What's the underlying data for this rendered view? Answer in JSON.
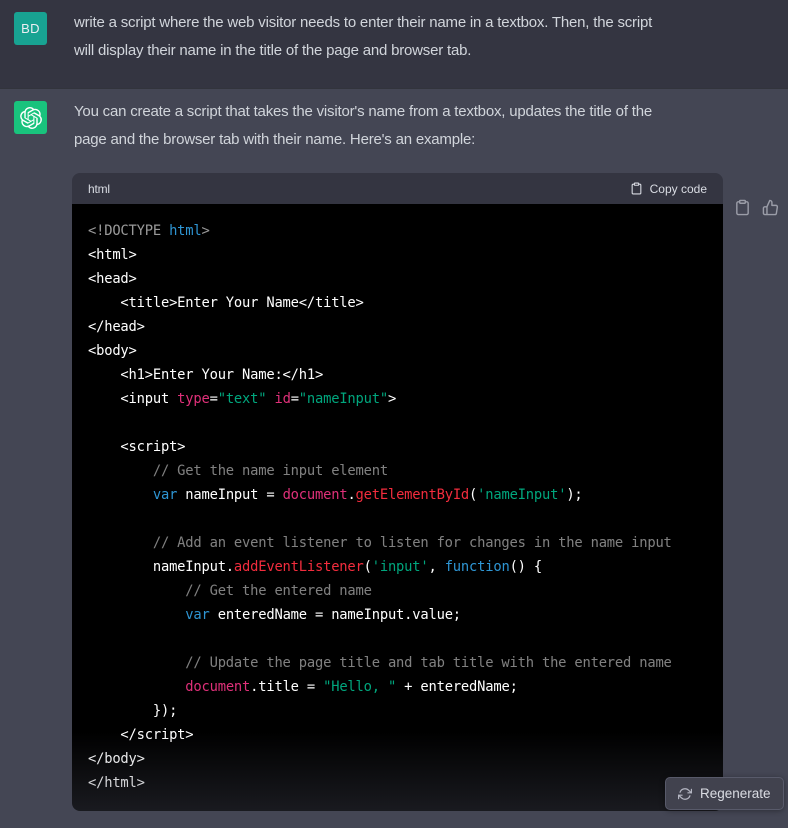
{
  "user_message": {
    "avatar_initials": "BD",
    "lines": [
      "write a script where the web visitor needs to enter their name in a textbox. Then, the script",
      "will display their name in the title of the page and browser tab."
    ]
  },
  "assistant_message": {
    "lines": [
      "You can create a script that takes the visitor's name from a textbox, updates the title of the",
      "page and the browser tab with their name. Here's an example:"
    ]
  },
  "code_block": {
    "language": "html",
    "copy_label": "Copy code",
    "token_colors": {
      "pln": "#ffffff",
      "com": "rgba(255,255,255,0.5)",
      "meta": "rgba(255,255,255,0.6)",
      "kw": "#2e95d3",
      "str": "#00a67d",
      "attr": "#df3079",
      "fn": "#f22c3d"
    },
    "lines": [
      [
        {
          "t": "<!DOCTYPE ",
          "c": "meta"
        },
        {
          "t": "html",
          "c": "kw"
        },
        {
          "t": ">",
          "c": "meta"
        }
      ],
      [
        {
          "t": "<html>",
          "c": "pln"
        }
      ],
      [
        {
          "t": "<head>",
          "c": "pln"
        }
      ],
      [
        {
          "t": "    <title>Enter Your Name</title>",
          "c": "pln"
        }
      ],
      [
        {
          "t": "</head>",
          "c": "pln"
        }
      ],
      [
        {
          "t": "<body>",
          "c": "pln"
        }
      ],
      [
        {
          "t": "    <h1>Enter Your Name:</h1>",
          "c": "pln"
        }
      ],
      [
        {
          "t": "    <input ",
          "c": "pln"
        },
        {
          "t": "type",
          "c": "attr"
        },
        {
          "t": "=",
          "c": "pln"
        },
        {
          "t": "\"text\"",
          "c": "str"
        },
        {
          "t": " ",
          "c": "pln"
        },
        {
          "t": "id",
          "c": "attr"
        },
        {
          "t": "=",
          "c": "pln"
        },
        {
          "t": "\"nameInput\"",
          "c": "str"
        },
        {
          "t": ">",
          "c": "pln"
        }
      ],
      [],
      [
        {
          "t": "    <script>",
          "c": "pln"
        }
      ],
      [
        {
          "t": "        // Get the name input element",
          "c": "com"
        }
      ],
      [
        {
          "t": "        ",
          "c": "pln"
        },
        {
          "t": "var",
          "c": "kw"
        },
        {
          "t": " nameInput = ",
          "c": "pln"
        },
        {
          "t": "document",
          "c": "attr"
        },
        {
          "t": ".",
          "c": "pln"
        },
        {
          "t": "getElementById",
          "c": "fn"
        },
        {
          "t": "(",
          "c": "pln"
        },
        {
          "t": "'nameInput'",
          "c": "str"
        },
        {
          "t": ");",
          "c": "pln"
        }
      ],
      [],
      [
        {
          "t": "        // Add an event listener to listen for changes in the name input",
          "c": "com"
        }
      ],
      [
        {
          "t": "        nameInput.",
          "c": "pln"
        },
        {
          "t": "addEventListener",
          "c": "fn"
        },
        {
          "t": "(",
          "c": "pln"
        },
        {
          "t": "'input'",
          "c": "str"
        },
        {
          "t": ", ",
          "c": "pln"
        },
        {
          "t": "function",
          "c": "kw"
        },
        {
          "t": "() {",
          "c": "pln"
        }
      ],
      [
        {
          "t": "            // Get the entered name",
          "c": "com"
        }
      ],
      [
        {
          "t": "            ",
          "c": "pln"
        },
        {
          "t": "var",
          "c": "kw"
        },
        {
          "t": " enteredName = nameInput.value;",
          "c": "pln"
        }
      ],
      [],
      [
        {
          "t": "            // Update the page title and tab title with the entered name",
          "c": "com"
        }
      ],
      [
        {
          "t": "            ",
          "c": "pln"
        },
        {
          "t": "document",
          "c": "attr"
        },
        {
          "t": ".title = ",
          "c": "pln"
        },
        {
          "t": "\"Hello, \"",
          "c": "str"
        },
        {
          "t": " + enteredName;",
          "c": "pln"
        }
      ],
      [
        {
          "t": "        });",
          "c": "pln"
        }
      ],
      [
        {
          "t": "    </script>",
          "c": "pln"
        }
      ],
      [
        {
          "t": "</body>",
          "c": "pln"
        }
      ],
      [
        {
          "t": "</html>",
          "c": "pln"
        }
      ]
    ]
  },
  "regenerate": {
    "label": "Regenerate"
  },
  "colors": {
    "user_row_bg": "#343541",
    "assistant_row_bg": "#444654",
    "code_header_bg": "#343541",
    "code_body_bg": "#000000",
    "user_avatar_bg": "#18a392",
    "assistant_avatar_bg": "#19c37d",
    "message_text": "#d1d5db"
  }
}
